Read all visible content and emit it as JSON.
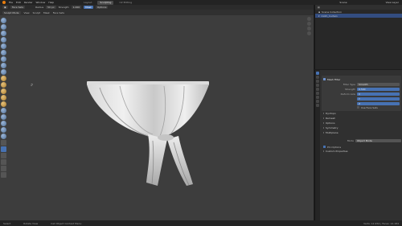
{
  "menus": [
    "File",
    "Edit",
    "Render",
    "Window",
    "Help"
  ],
  "workspace_tabs": [
    {
      "label": "Layout",
      "active": false
    },
    {
      "label": "Sculpting",
      "active": true
    },
    {
      "label": "UV Editing",
      "active": false
    }
  ],
  "scene_label": "Scene",
  "view_layer_label": "View Layer",
  "header": {
    "mode": "Sculpt Mode",
    "brush_type": "Face Sets",
    "radius_label": "Radius",
    "radius_value": "50 px",
    "strength_label": "Strength",
    "strength_value": "1.000",
    "mask_label": "Mask",
    "display_label": "Options"
  },
  "tool_header": [
    "Sculpt Mode",
    "View",
    "Sculpt",
    "Mask",
    "Face Sets"
  ],
  "outliner": {
    "title": "Scene Collection",
    "rows": [
      {
        "label": "Collection",
        "selected": false
      },
      {
        "label": "Cloth_Curtain",
        "selected": true
      }
    ]
  },
  "modifier": {
    "name": "Mesh Filter",
    "filter_type_label": "Filter Type",
    "filter_type_value": "Smooth",
    "strength_label": "Strength",
    "strength_value": "0.500",
    "deform_axis_label": "Deform Axis",
    "axes": [
      "X",
      "Y",
      "Z"
    ],
    "use_face_sets_label": "Use Face Sets",
    "subpanels": [
      "Dyntopo",
      "Remesh",
      "Options",
      "Symmetry",
      "Multiplane"
    ],
    "mode_label": "Mode",
    "mode_value": "Object Mode",
    "pin_label": "Pin Options",
    "custom_label": "Custom Properties"
  },
  "status": {
    "left": "Select",
    "middle": "Rotate View",
    "right_hint": "Call Object Context Menu",
    "stats": "Verts: 12.454 | Faces: 12.184"
  },
  "colors": {
    "accent": "#4772b3",
    "viewport": "#3d3d3d",
    "panel": "#303030",
    "logo": "#e87d0d"
  }
}
